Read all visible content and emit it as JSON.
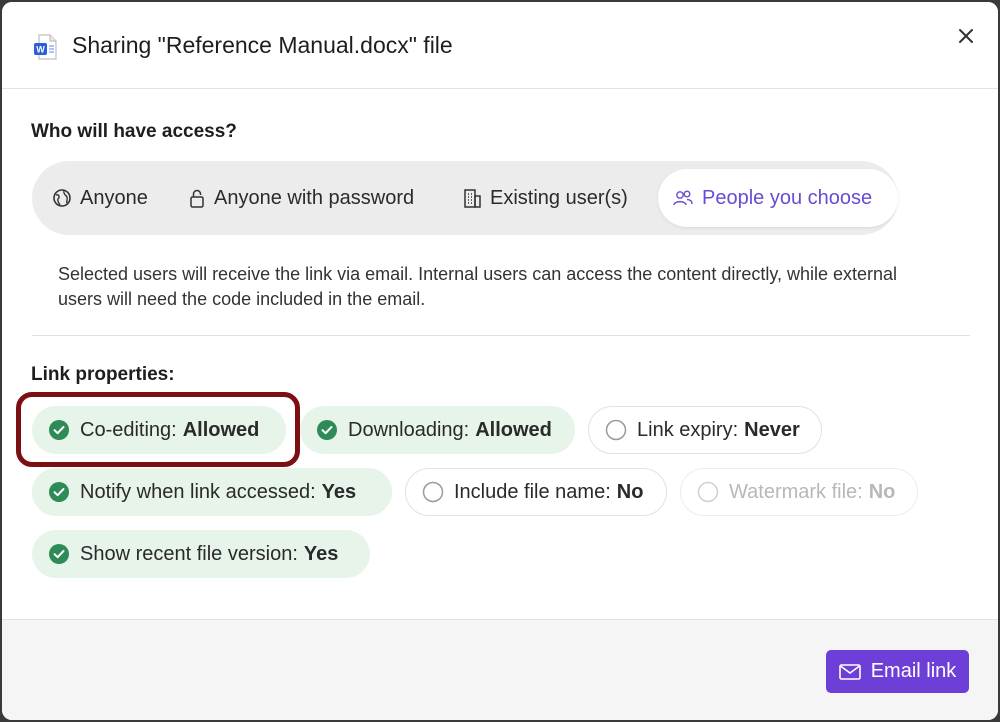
{
  "dialog": {
    "title": "Sharing \"Reference Manual.docx\" file",
    "file_icon": "word-document-icon",
    "close_icon": "close-icon"
  },
  "access": {
    "heading": "Who will have access?",
    "options": [
      {
        "label": "Anyone",
        "icon": "globe-icon",
        "selected": false
      },
      {
        "label": "Anyone with password",
        "icon": "lock-icon",
        "selected": false
      },
      {
        "label": "Existing user(s)",
        "icon": "building-icon",
        "selected": false
      },
      {
        "label": "People you choose",
        "icon": "people-icon",
        "selected": true
      }
    ],
    "description": "Selected users will receive the link via email. Internal users can access the content directly, while external users will need the code included in the email."
  },
  "link_properties": {
    "heading": "Link properties:",
    "items": [
      {
        "label": "Co-editing:",
        "value": "Allowed",
        "state": "on"
      },
      {
        "label": "Downloading:",
        "value": "Allowed",
        "state": "on"
      },
      {
        "label": "Link expiry:",
        "value": "Never",
        "state": "off"
      },
      {
        "label": "Notify when link accessed:",
        "value": "Yes",
        "state": "on"
      },
      {
        "label": "Include file name:",
        "value": "No",
        "state": "off"
      },
      {
        "label": "Watermark file:",
        "value": "No",
        "state": "disabled"
      },
      {
        "label": "Show recent file version:",
        "value": "Yes",
        "state": "on"
      }
    ]
  },
  "footer": {
    "email_button_label": "Email link",
    "email_icon": "envelope-icon"
  },
  "colors": {
    "accent": "#6d3fd6",
    "selected_text": "#6b4bd1",
    "chip_on_bg": "#e6f4ea",
    "check_green": "#2e8b57",
    "highlight_border": "#7b0f14"
  }
}
